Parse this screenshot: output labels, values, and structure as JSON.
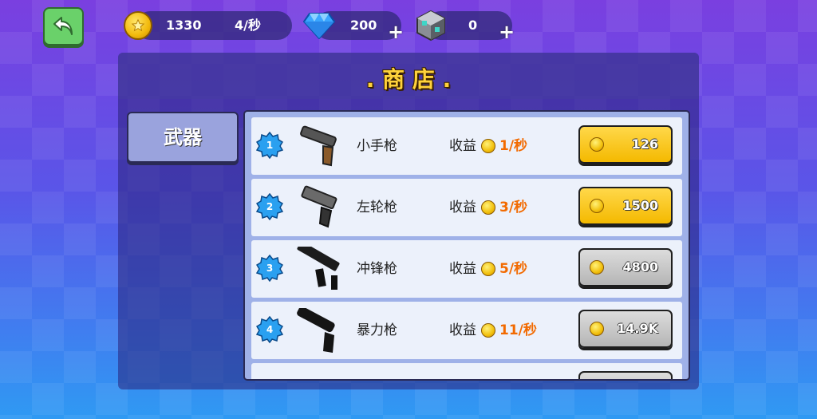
{
  "header": {
    "gold": "1330",
    "gold_rate": "4/秒",
    "diamonds": "200",
    "cubes": "0",
    "plus": "+"
  },
  "shop": {
    "title": ". 商 店 .",
    "tab_label": "武器",
    "income_label": "收益",
    "items": [
      {
        "level": "1",
        "name": "小手枪",
        "income": "1/秒",
        "price": "126",
        "button": "yellow",
        "icon": "pistol-icon"
      },
      {
        "level": "2",
        "name": "左轮枪",
        "income": "3/秒",
        "price": "1500",
        "button": "yellow",
        "icon": "desert-eagle-icon"
      },
      {
        "level": "3",
        "name": "冲锋枪",
        "income": "5/秒",
        "price": "4800",
        "button": "gray",
        "icon": "smg-icon"
      },
      {
        "level": "4",
        "name": "暴力枪",
        "income": "11/秒",
        "price": "14.9K",
        "button": "gray",
        "icon": "shotgun-icon"
      }
    ]
  },
  "colors": {
    "accent_yellow": "#f4b900",
    "income_orange": "#f26a00",
    "title_gold": "#ffd23b"
  }
}
